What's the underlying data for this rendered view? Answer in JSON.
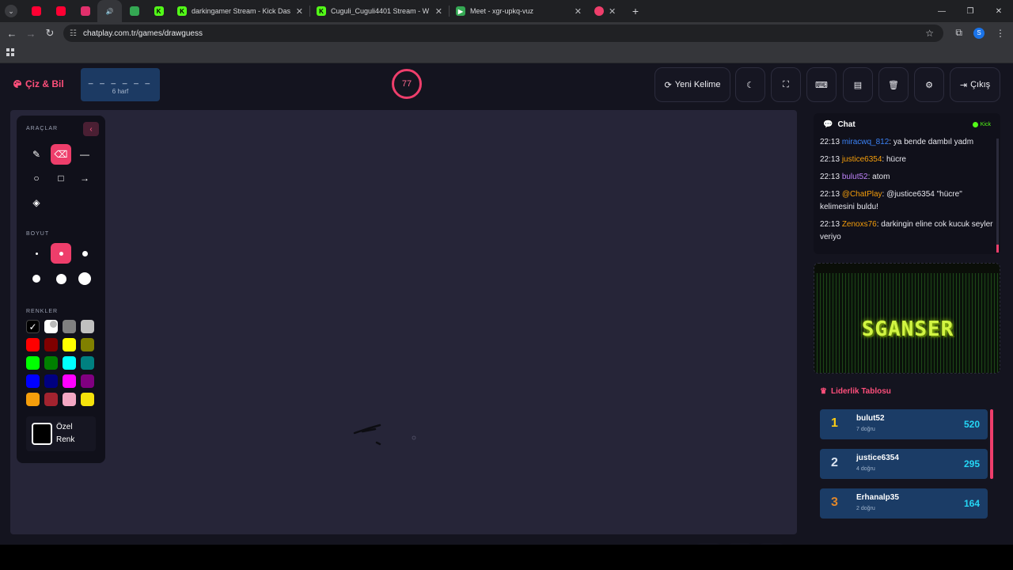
{
  "browser": {
    "pinned_tabs": [
      {
        "icon": "youtube-music-icon",
        "color": "#ff0033"
      },
      {
        "icon": "youtube-icon",
        "color": "#ff0033"
      },
      {
        "icon": "instagram-icon",
        "color": "#e1306c"
      },
      {
        "icon": "audio-icon",
        "color": "#8e8e94"
      },
      {
        "icon": "meet-icon",
        "color": "#34a853"
      },
      {
        "icon": "kick-icon",
        "color": "#53fc18"
      }
    ],
    "tabs": [
      {
        "title": "darkingamer Stream - Kick Das",
        "icon": "kick-icon"
      },
      {
        "title": "Cuguli_Cuguli4401 Stream - W",
        "icon": "kick-icon"
      },
      {
        "title": "Meet - xgr-upkq-vuz",
        "icon": "meet-icon"
      }
    ],
    "url": "chatplay.com.tr/games/drawguess",
    "profile_initial": "S"
  },
  "header": {
    "brand": "Çiz & Bil",
    "word_mask": "_ _ _ _ _ _",
    "word_length": "6 harf",
    "timer": "77",
    "new_word": "Yeni Kelime",
    "exit": "Çıkış"
  },
  "tools": {
    "tools_title": "ARAÇLAR",
    "size_title": "BOYUT",
    "colors_title": "RENKLER",
    "custom_color": "Özel Renk",
    "colors": [
      "#000000",
      "#ffffff",
      "#808080",
      "#c0c0c0",
      "#ff0000",
      "#800000",
      "#ffff00",
      "#808000",
      "#00ff00",
      "#008000",
      "#00ffff",
      "#008080",
      "#0000ff",
      "#000080",
      "#ff00ff",
      "#800080",
      "#f59e0b",
      "#a3232f",
      "#f4a7c3",
      "#f5e20b"
    ]
  },
  "chat": {
    "title": "Chat",
    "platform": "Kick",
    "messages": [
      {
        "time": "22:13",
        "user": "miracwq_812",
        "color": "#3b82f6",
        "text": ": ya bende dambıl yadm"
      },
      {
        "time": "22:13",
        "user": "justice6354",
        "color": "#f59e0b",
        "text": ": hücre"
      },
      {
        "time": "22:13",
        "user": "bulut52",
        "color": "#c084fc",
        "text": ": atom"
      },
      {
        "time": "22:13",
        "user": "@ChatPlay",
        "color": "#f59e0b",
        "text": ": @justice6354 \"hücre\" kelimesini buldu!"
      },
      {
        "time": "22:13",
        "user": "Zenoxs76",
        "color": "#f59e0b",
        "text": ": darkingin eline cok kucuk seyler veriyo"
      }
    ]
  },
  "banner": {
    "text": "SGANSER"
  },
  "leaderboard": {
    "title": "Liderlik Tablosu",
    "rows": [
      {
        "rank": "1",
        "name": "bulut52",
        "sub": "7 doğru",
        "score": "520",
        "rank_color": "#facc15"
      },
      {
        "rank": "2",
        "name": "justice6354",
        "sub": "4 doğru",
        "score": "295",
        "rank_color": "#dbe4f0"
      },
      {
        "rank": "3",
        "name": "Erhanalp35",
        "sub": "2 doğru",
        "score": "164",
        "rank_color": "#e0872b"
      }
    ]
  }
}
